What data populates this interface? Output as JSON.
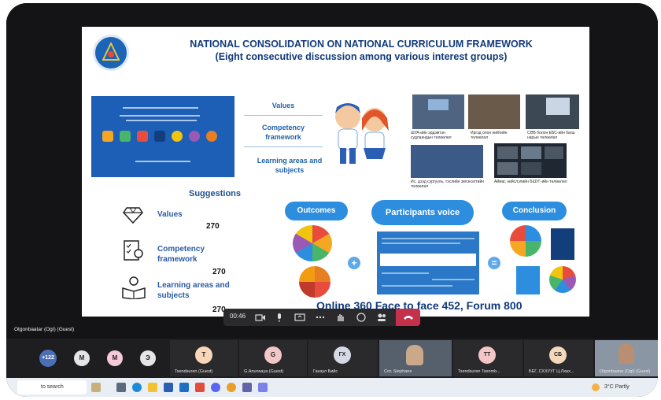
{
  "slide": {
    "title_line1": "NATIONAL CONSOLIDATION ON NATIONAL CURRICULUM FRAMEWORK",
    "title_line2": "(Eight consecutive discussion among various interest groups)",
    "center_labels": [
      "Values",
      "Competency framework",
      "Learning areas and subjects"
    ],
    "photo_captions": [
      "ШУА-ийн эрдэмтэн судлаачдын төлөөлөл",
      "Иргэд олон нийтийн төлөөлөл",
      "СӨБ болон ЕБС-ийн багш нарын төлөөлөл",
      "Ис, дээд сургууль, тэслийн эмгэнэлтийн төлөөлөл",
      "Аймаг, нийслэлийн БШУГ-ийн төлөөлөл"
    ],
    "suggestions_title": "Suggestions",
    "suggestions": [
      {
        "label": "Values",
        "value": "270",
        "icon": "diamond-icon"
      },
      {
        "label": "Competency framework",
        "value": "270",
        "icon": "checklist-icon"
      },
      {
        "label": "Learning areas and subjects",
        "value": "270",
        "icon": "reading-icon"
      }
    ],
    "outcomes": "Outcomes",
    "participants_voice": "Participants voice",
    "conclusion": "Conclusion",
    "online_label": "Online",
    "online_value": "360",
    "f2f_label": "Face to face",
    "f2f_value": "452,",
    "forum_label": "Forum",
    "forum_value": "800"
  },
  "toolbar": {
    "time": "00:46"
  },
  "presenter_label": "Otgonbaatar (OgI) (Guest)",
  "participants": [
    {
      "initials": "+122",
      "color": "#4a6fb5",
      "name": ""
    },
    {
      "initials": "M",
      "color": "#e5e5e5",
      "name": ""
    },
    {
      "initials": "M",
      "color": "#f6c9d8",
      "name": ""
    },
    {
      "initials": "Э",
      "color": "#e5e5e5",
      "name": ""
    },
    {
      "initials": "T",
      "color": "#f8d6b8",
      "name": "Tsendsuren (Guest)"
    },
    {
      "initials": "G",
      "color": "#f3c7c7",
      "name": "G.Anunsaya (Guest)"
    },
    {
      "initials": "ГХ",
      "color": "#d4d9e5",
      "name": "Ганзул Бийс"
    },
    {
      "initials": "",
      "color": "#6b7a8a",
      "name": "Сот. Stephane"
    },
    {
      "initials": "TT",
      "color": "#f3c7c7",
      "name": "Tsendsuren Tsenmb..."
    },
    {
      "initials": "СБ",
      "color": "#f4d8bb",
      "name": "БЕГ, СХХУУГ Ц.Лхах..."
    },
    {
      "initials": "",
      "color": "#8a96a3",
      "name": "Otgonbaatar (OgI) (Guest)"
    }
  ],
  "taskbar": {
    "search_text": "to search",
    "weather": "3°C  Partly"
  }
}
